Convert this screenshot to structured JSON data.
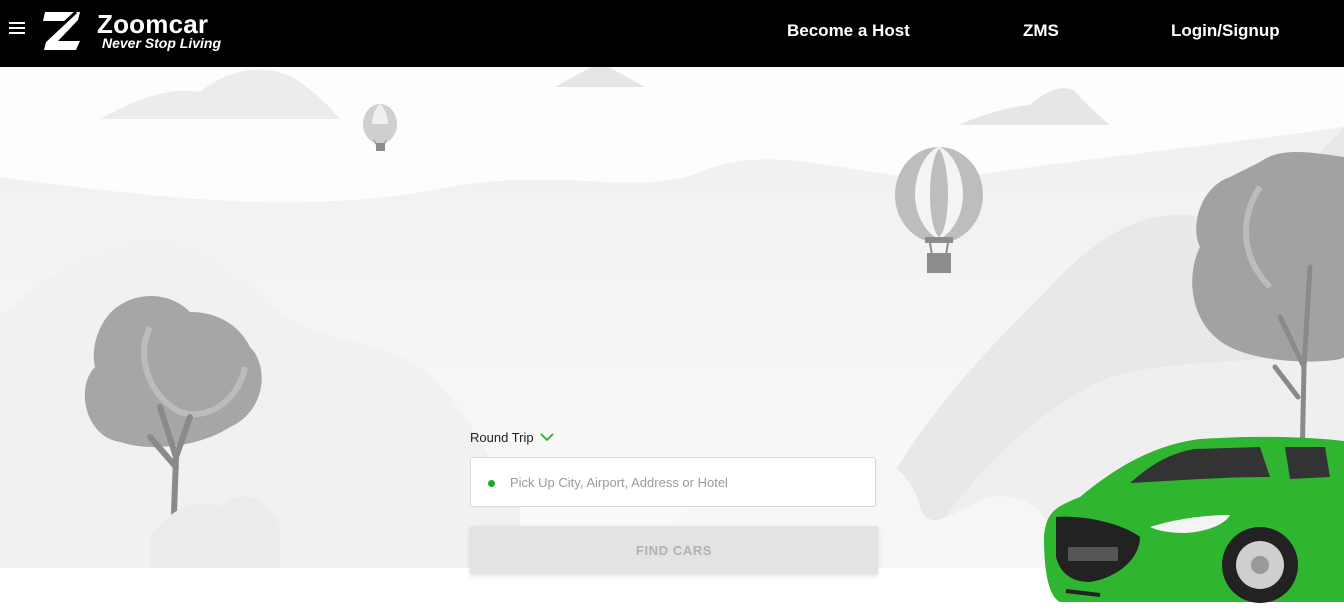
{
  "header": {
    "brand": "Zoomcar",
    "tagline": "Never Stop Living",
    "nav": {
      "host": "Become a Host",
      "zms": "ZMS",
      "login": "Login/Signup"
    }
  },
  "search": {
    "trip_type": "Round Trip",
    "pickup_placeholder": "Pick Up City, Airport, Address or Hotel",
    "find_label": "FIND CARS"
  },
  "colors": {
    "header_bg": "#000000",
    "accent_green": "#2fb52f",
    "button_bg": "#e3e3e3"
  },
  "icons": [
    "menu-icon",
    "zoomcar-logo-icon",
    "chevron-down-icon",
    "location-dot-icon"
  ]
}
